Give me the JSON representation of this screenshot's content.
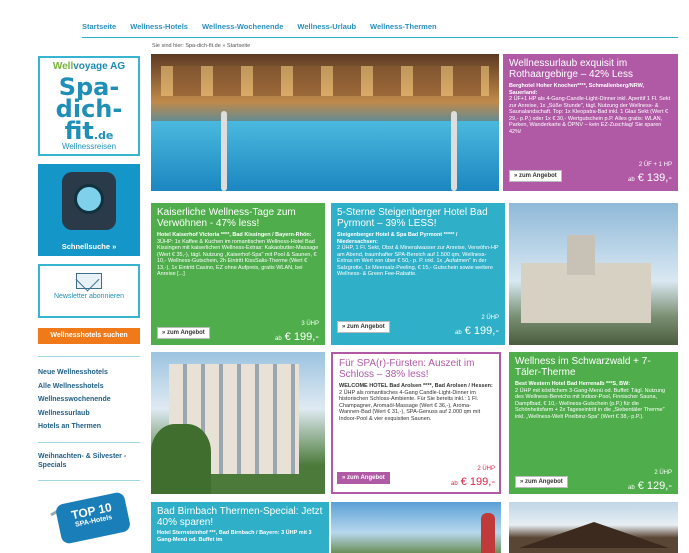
{
  "nav": {
    "items": [
      "Startseite",
      "Wellness-Hotels",
      "Wellness-Wochenende",
      "Wellness-Urlaub",
      "Wellness-Thermen"
    ]
  },
  "breadcrumb": "Sie sind hier: Spa-dich-fit.de » Startseite",
  "sidebar": {
    "logo_top_a": "Well",
    "logo_top_b": "voyage AG",
    "logo_spa": "Spa-",
    "logo_dich": "dich-",
    "logo_fit": "fit",
    "logo_de": ".de",
    "logo_bottom": "Wellnessreisen",
    "schnellsuche": "Schnellsuche »",
    "newsletter": "Newsletter abonnieren",
    "orange_button": "Wellnesshotels suchen",
    "links": [
      "Neue Wellnesshotels",
      "Alle Wellnesshotels",
      "Wellnesswochenende",
      "Wellnessurlaub",
      "Hotels an Thermen"
    ],
    "special": "Weihnachten- & Silvester - Specials",
    "top10_big": "TOP 10",
    "top10_small": "SPA-Hotels"
  },
  "hero": {
    "title": "Wellnessurlaub exquisit im Rothaargebirge – 42% Less",
    "hotel": "Berghotel Hoher Knochen****, Schmallenberg/NRW, Sauerland:",
    "desc": "2 ÜF+1 HP als 4-Gang-Candle-Light-Dinner inkl. Aperitif 1 Fl. Sekt zur Anreise, 1x „Süße Stunde\", tägl. Nutzung der Wellness- & Saunalandschaft. Top: 1x Kleopatra-Bad inkl. 1 Glas Sekt (Wert € 29,- p.P.) oder 1x € 30,- Wertgutschein p.P. Alles gratis: WLAN, Parken, Wanderkarte & ÖPNV – kein EZ-Zuschlag! Sie sparen 42%!",
    "uhp": "2 ÜF + 1 HP",
    "price_prefix": "ab",
    "price": "€ 139,-",
    "button": "» zum Angebot"
  },
  "cards": [
    {
      "title": "Kaiserliche Wellness-Tage zum Verwöhnen - 47% less!",
      "hotel": "Hotel Kaiserhof Victoria ****, Bad Kissingen / Bayern-Rhön:",
      "desc": "3ÜHP: 1x Kaffee & Kuchen im romantischen Wellness-Hotel Bad Kissingen mit kaiserlichen Wellness-Extras: Kakaobutter-Massage (Wert € 35,-), tägl. Nutzung „Kaiserhof-Spa\" mit Pool & Saunen, € 10,- Wellness-Gutschein, 2h Eintritt KissSalis-Therme (Wert € 13,-), 1x Eintritt Casino, EZ ohne Aufpreis, gratis WLAN, bei Anreise [...]",
      "uhp": "3 ÜHP",
      "price": "€ 199,-",
      "button": "» zum Angebot"
    },
    {
      "title": "5-Sterne Steigenberger Hotel Bad Pyrmont – 39% LESS!",
      "hotel": "Steigenberger Hotel & Spa Bad Pyrmont ***** / Niedersachsen:",
      "desc": "2 ÜHP, 1 Fl. Sekt, Obst & Mineralwasser zur Anreise, Verwöhn-HP am Abend, traumhafter SPA-Bereich auf 1.500 qm, Wellness-Extras im Wert von über € 50,- p. P. inkl. 1x „Aufatmen\" in der Salzgrotte, 1x Meersalz-Peeling, € 15,- Gutschein sowie weitere Wellness- & Green Fee-Rabatte.",
      "uhp": "2 ÜHP",
      "price": "€ 199,-",
      "button": "» zum Angebot"
    },
    {
      "title": "Für SPA(r)-Fürsten: Auszeit im Schloss – 38% less!",
      "hotel": "WELCOME HOTEL Bad Arolsen ****, Bad Arolsen / Hessen:",
      "desc": "2 ÜHP als romantisches 4-Gang Candle-Light-Dinner im historischen Schloss-Ambiente. Für Sie bereits inkl.: 1 Fl. Champagner, Aromaöl-Massage (Wert € 36,-), Aroma-Wannen-Bad (Wert € 31,-), SPA-Genuss auf 2.000 qm mit Indoor-Pool & vier exquisiten Saunen.",
      "uhp": "2 ÜHP",
      "price": "€ 199,-",
      "button": "» zum Angebot"
    },
    {
      "title": "Wellness im Schwarzwald + 7-Täler-Therme",
      "hotel": "Best Western Hotel Bad Herrenalb ***S, BW:",
      "desc": "2 ÜHP mit köstlichem 3-Gang-Menü od. Buffet: Tägl. Nutzung des Wellness-Bereichs mit Indoor-Pool, Finnischer Sauna, Dampfbad, € 10,- Wellness-Gutschein (p.P.) für die Schönheitsfarm + 2x Tageseintritt in die „Siebentäler Therme\" inkl. „Wellness-Welt Pirelbinz-Spa\" (Wert € 38,- p.P.).",
      "uhp": "2 ÜHP",
      "price": "€ 129,-",
      "button": "» zum Angebot"
    }
  ],
  "bottom_card": {
    "title": "Bad Birnbach Thermen-Special: Jetzt 40% sparen!",
    "hotel": "Hotel Sternsteinhof ***, Bad Birnbach / Bayern: 3 ÜHP mit 3 Gang-Menü od. Buffet im"
  }
}
